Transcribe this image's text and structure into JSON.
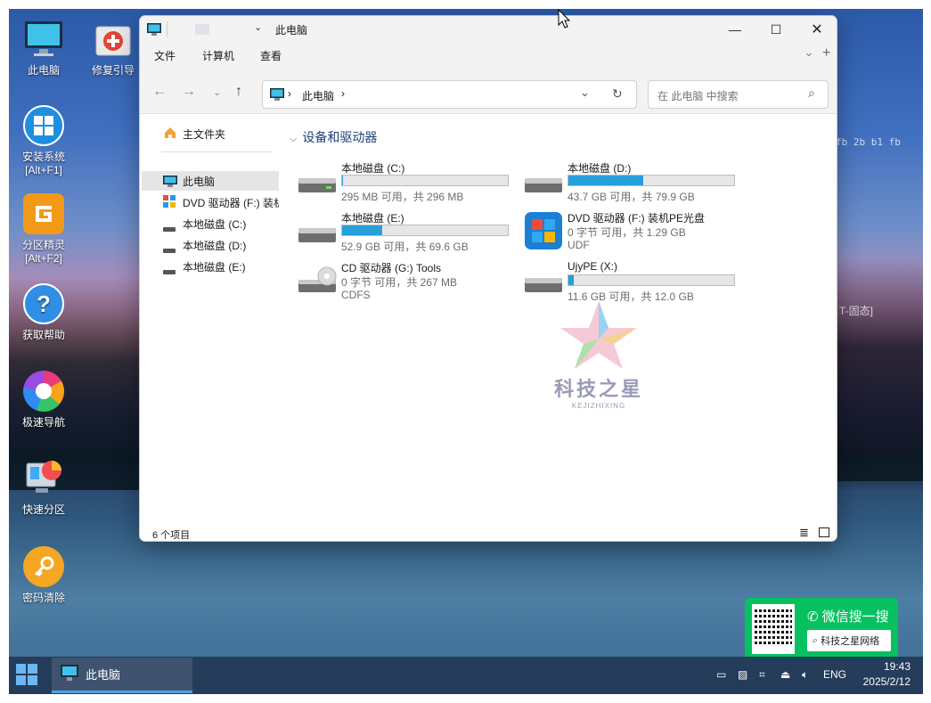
{
  "desktop": {
    "icons": [
      {
        "label": "此电脑"
      },
      {
        "label": "修复引导"
      },
      {
        "label": "安装系统",
        "sub": "[Alt+F1]"
      },
      {
        "label": "分区精灵",
        "sub": "[Alt+F2]"
      },
      {
        "label": "获取帮助"
      },
      {
        "label": "极速导航"
      },
      {
        "label": "快速分区"
      },
      {
        "label": "密码清除"
      }
    ],
    "side_text_1": "fb 2b b1 fb",
    "side_text_2": "T-固态]"
  },
  "window": {
    "title": "此电脑",
    "menu": [
      "文件",
      "计算机",
      "查看"
    ],
    "address": {
      "location": "此电脑",
      "search_placeholder": "在 此电脑 中搜索"
    },
    "sidebar": {
      "items": [
        {
          "label": "主文件夹"
        },
        {
          "label": "此电脑"
        },
        {
          "label": "DVD 驱动器 (F:) 装机"
        },
        {
          "label": "本地磁盘 (C:)"
        },
        {
          "label": "本地磁盘 (D:)"
        },
        {
          "label": "本地磁盘 (E:)"
        }
      ]
    },
    "group_title": "设备和驱动器",
    "drives": [
      {
        "name": "本地磁盘 (C:)",
        "info": "295 MB 可用，共 296 MB",
        "used_fraction": 0.003,
        "fs": ""
      },
      {
        "name": "本地磁盘 (D:)",
        "info": "43.7 GB 可用，共 79.9 GB",
        "used_fraction": 0.45,
        "fs": ""
      },
      {
        "name": "本地磁盘 (E:)",
        "info": "52.9 GB 可用，共 69.6 GB",
        "used_fraction": 0.24,
        "fs": ""
      },
      {
        "name": "DVD 驱动器 (F:) 装机PE光盘",
        "info": "0 字节 可用，共 1.29 GB",
        "fs": "UDF"
      },
      {
        "name": "CD 驱动器 (G:) Tools",
        "info": "0 字节 可用，共 267 MB",
        "fs": "CDFS"
      },
      {
        "name": "UjyPE (X:)",
        "info": "11.6 GB 可用，共 12.0 GB",
        "used_fraction": 0.03,
        "fs": ""
      }
    ],
    "status": "6 个项目"
  },
  "watermark": {
    "text": "科技之星",
    "sub": "KEJIZHIXING"
  },
  "badge": {
    "title": "微信搜一搜",
    "search": "科技之星网络"
  },
  "taskbar": {
    "app_label": "此电脑",
    "lang": "ENG",
    "time": "19:43",
    "date": "2025/2/12"
  },
  "colors": {
    "accent": "#26a0da",
    "wechat": "#07c160"
  }
}
